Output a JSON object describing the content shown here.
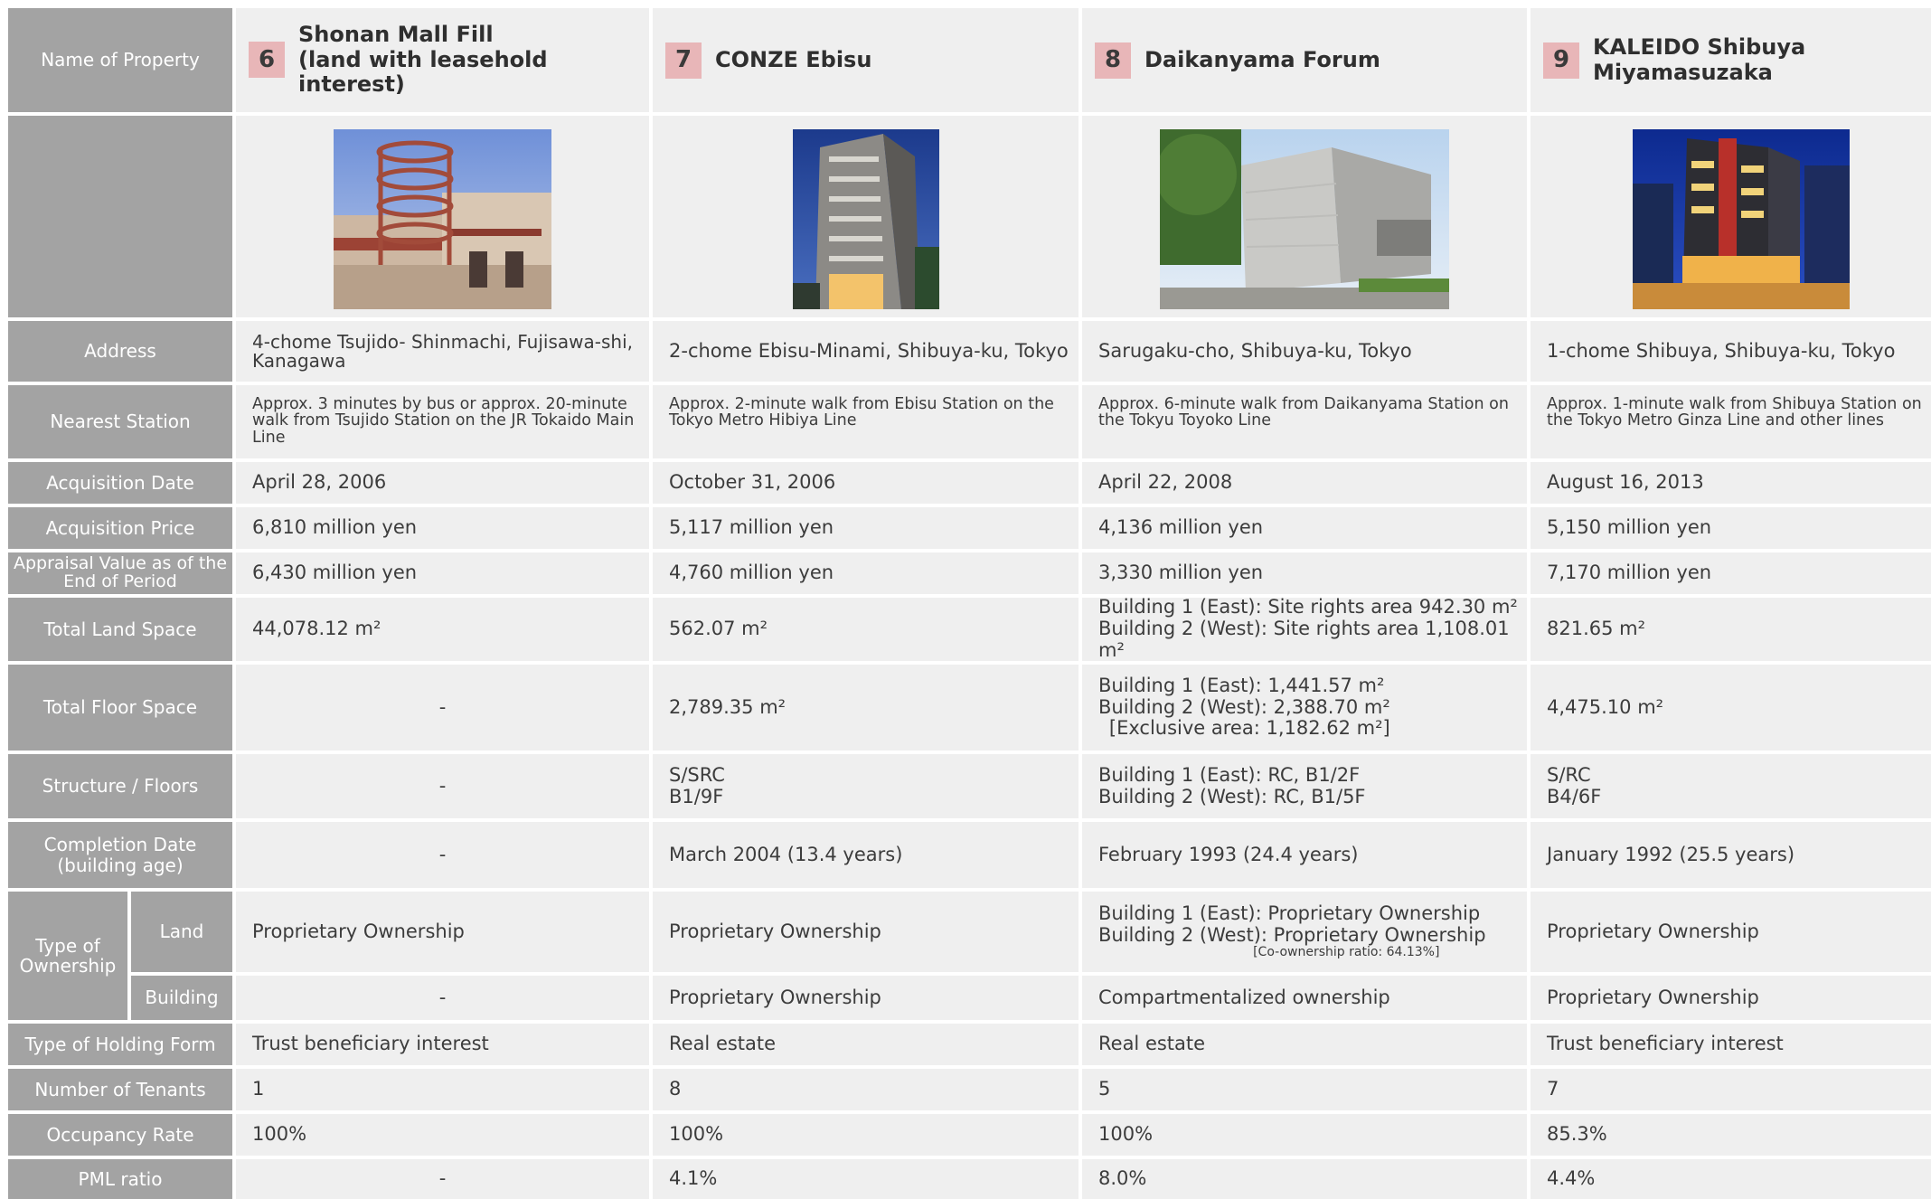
{
  "row_labels": {
    "name": "Name of Property",
    "address": "Address",
    "station": "Nearest Station",
    "acq_date": "Acquisition Date",
    "acq_price": "Acquisition Price",
    "appraisal": "Appraisal Value as of the End of Period",
    "land_space": "Total Land Space",
    "floor_space": "Total Floor Space",
    "structure": "Structure / Floors",
    "completion": "Completion Date (building age)",
    "ownership": "Type of Ownership",
    "ownership_land": "Land",
    "ownership_building": "Building",
    "holding": "Type of Holding Form",
    "tenants": "Number of Tenants",
    "occupancy": "Occupancy Rate",
    "pml": "PML ratio"
  },
  "properties": [
    {
      "number": "6",
      "name_line1": "Shonan Mall Fill",
      "name_line2": "(land with leasehold interest)",
      "photo": "shopping-mall-photo",
      "address": "4-chome Tsujido- Shinmachi, Fujisawa-shi, Kanagawa",
      "station": "Approx. 3 minutes by bus or approx. 20-minute walk from Tsujido Station on the JR Tokaido Main Line",
      "acq_date": "April 28, 2006",
      "acq_price": "6,810 million yen",
      "appraisal": "6,430 million yen",
      "land_1": "44,078.12 m²",
      "land_2": "",
      "floor_1": "-",
      "floor_2": "",
      "floor_3": "",
      "structure_1": "-",
      "structure_2": "",
      "completion": "-",
      "own_land_1": "Proprietary Ownership",
      "own_land_2": "",
      "own_land_note": "",
      "own_building": "-",
      "holding": "Trust beneficiary interest",
      "tenants": "1",
      "occupancy": "100%",
      "pml": "-"
    },
    {
      "number": "7",
      "name_line1": "CONZE Ebisu",
      "name_line2": "",
      "photo": "office-building-photo",
      "address": "2-chome Ebisu-Minami, Shibuya-ku, Tokyo",
      "station": "Approx. 2-minute walk from Ebisu Station on the Tokyo Metro Hibiya Line",
      "acq_date": "October 31, 2006",
      "acq_price": "5,117 million yen",
      "appraisal": "4,760 million yen",
      "land_1": "562.07 m²",
      "land_2": "",
      "floor_1": "2,789.35 m²",
      "floor_2": "",
      "floor_3": "",
      "structure_1": "S/SRC",
      "structure_2": "B1/9F",
      "completion": "March 2004 (13.4 years)",
      "own_land_1": "Proprietary Ownership",
      "own_land_2": "",
      "own_land_note": "",
      "own_building": "Proprietary Ownership",
      "holding": "Real estate",
      "tenants": "8",
      "occupancy": "100%",
      "pml": "4.1%"
    },
    {
      "number": "8",
      "name_line1": "Daikanyama Forum",
      "name_line2": "",
      "photo": "concrete-building-photo",
      "address": "Sarugaku-cho, Shibuya-ku, Tokyo",
      "station": "Approx. 6-minute walk from Daikanyama Station on the Tokyu Toyoko Line",
      "acq_date": "April 22, 2008",
      "acq_price": "4,136 million yen",
      "appraisal": "3,330 million yen",
      "land_1": "Building 1 (East): Site rights area 942.30 m²",
      "land_2": "Building 2 (West): Site rights area 1,108.01 m²",
      "floor_1": "Building 1 (East): 1,441.57 m²",
      "floor_2": "Building 2 (West): 2,388.70 m²",
      "floor_3": "[Exclusive area: 1,182.62 m²]",
      "structure_1": "Building 1 (East): RC, B1/2F",
      "structure_2": "Building 2 (West): RC, B1/5F",
      "completion": "February 1993 (24.4 years)",
      "own_land_1": "Building 1 (East): Proprietary Ownership",
      "own_land_2": "Building 2 (West): Proprietary Ownership",
      "own_land_note": "[Co-ownership ratio: 64.13%]",
      "own_building": "Compartmentalized ownership",
      "holding": "Real estate",
      "tenants": "5",
      "occupancy": "100%",
      "pml": "8.0%"
    },
    {
      "number": "9",
      "name_line1": "KALEIDO Shibuya",
      "name_line2": "Miyamasuzaka",
      "photo": "night-building-photo",
      "address": "1-chome Shibuya, Shibuya-ku, Tokyo",
      "station": "Approx. 1-minute walk from Shibuya Station on the Tokyo Metro Ginza Line and other lines",
      "acq_date": "August 16, 2013",
      "acq_price": "5,150 million yen",
      "appraisal": "7,170 million yen",
      "land_1": "821.65 m²",
      "land_2": "",
      "floor_1": "4,475.10 m²",
      "floor_2": "",
      "floor_3": "",
      "structure_1": "S/RC",
      "structure_2": "B4/6F",
      "completion": "January 1992 (25.5 years)",
      "own_land_1": "Proprietary Ownership",
      "own_land_2": "",
      "own_land_note": "",
      "own_building": "Proprietary Ownership",
      "holding": "Trust beneficiary interest",
      "tenants": "7",
      "occupancy": "85.3%",
      "pml": "4.4%"
    }
  ]
}
